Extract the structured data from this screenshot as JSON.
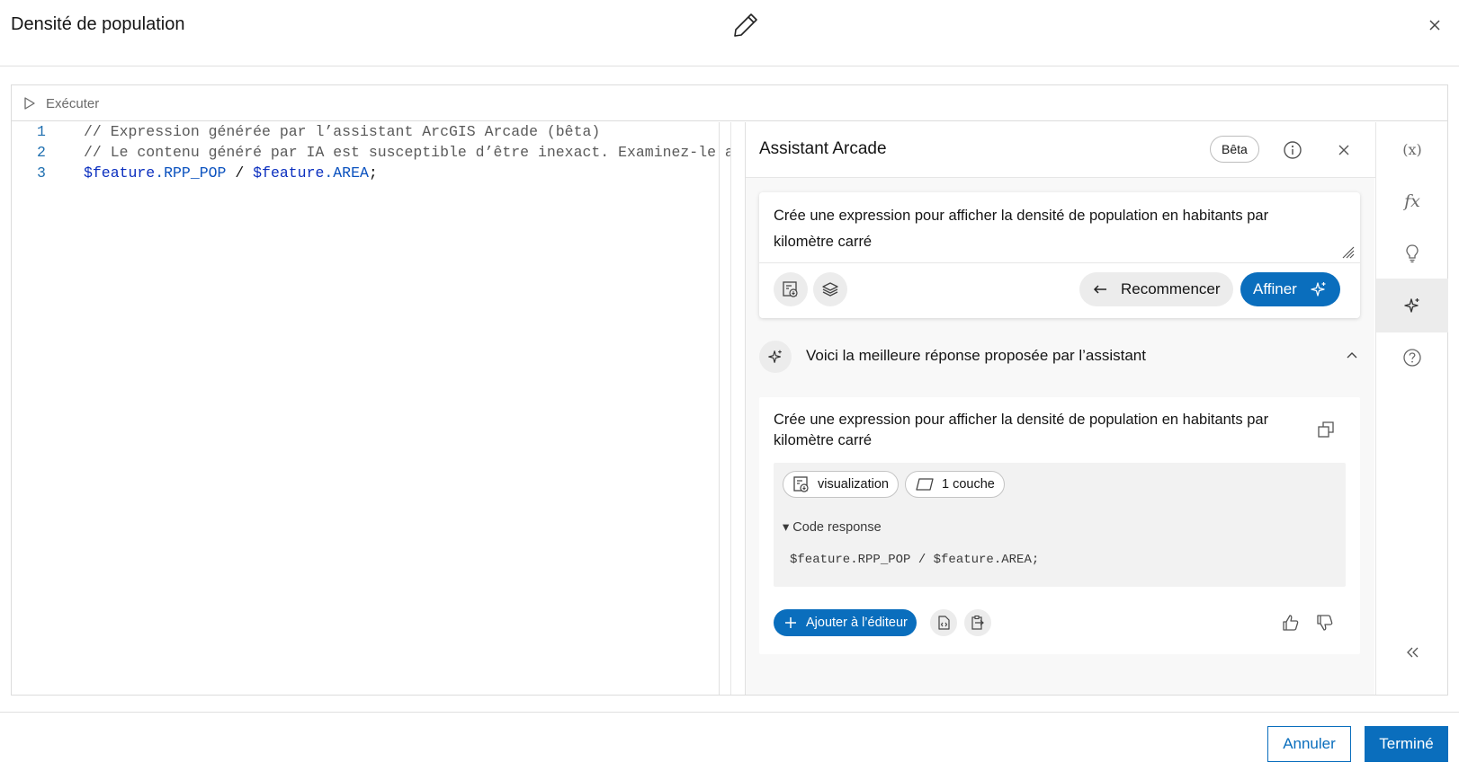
{
  "dialog": {
    "title": "Densité de population",
    "edit_icon": "pencil-icon",
    "close_icon": "close-icon"
  },
  "run_bar": {
    "run_label": "Exécuter",
    "run_icon": "play-icon"
  },
  "editor": {
    "lines": [
      {
        "number": "1",
        "text": "// Expression générée par l’assistant ArcGIS Arcade (bêta)"
      },
      {
        "number": "2",
        "text": "// Le contenu généré par IA est susceptible d’être inexact. Examinez-le avant"
      },
      {
        "number": "3",
        "var1": "$feature",
        "prop1": ".RPP_POP",
        "op": " / ",
        "var2": "$feature",
        "prop2": ".AREA",
        "end": ";"
      }
    ]
  },
  "assistant": {
    "title": "Assistant Arcade",
    "beta_badge": "Bêta",
    "info_icon": "info-icon",
    "close_icon": "close-icon",
    "prompt": {
      "text": "Crée une expression pour afficher la densité de population en habitants par kilomètre carré",
      "visualization_icon": "visualization-icon",
      "layers_icon": "layers-icon",
      "restart_label": "Recommencer",
      "restart_icon": "arrow-left-icon",
      "refine_label": "Affiner",
      "refine_icon": "sparkle-icon"
    },
    "response": {
      "heading": "Voici la meilleure réponse proposée par l’assistant",
      "question": "Crée une expression pour afficher la densité de population en habitants par kilomètre carré",
      "chips": [
        {
          "label": "visualization",
          "icon": "visualization-icon"
        },
        {
          "label": "1 couche",
          "icon": "layer-icon"
        }
      ],
      "code_summary": "▾ Code response",
      "code": "$feature.RPP_POP / $feature.AREA;",
      "add_label": "Ajouter à l’éditeur",
      "add_icon": "plus-icon"
    }
  },
  "toolbar": {
    "items": [
      {
        "label": "(x)",
        "icon": "variables-icon"
      },
      {
        "label": "fx",
        "icon": "functions-icon"
      },
      {
        "icon": "lightbulb-icon"
      },
      {
        "icon": "sparkle-icon",
        "active": true
      },
      {
        "icon": "help-icon"
      }
    ],
    "collapse_icon": "chevrons-left-icon"
  },
  "footer": {
    "cancel_label": "Annuler",
    "done_label": "Terminé"
  },
  "colors": {
    "accent": "#0a6ebd",
    "code_var": "#0b2fbf",
    "line_number": "#1f6fb0"
  }
}
